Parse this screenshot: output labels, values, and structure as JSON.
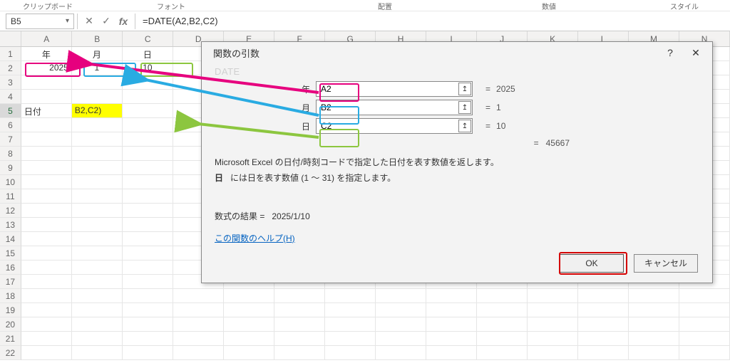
{
  "ribbon_groups": {
    "g1": "クリップボード",
    "g2": "フォント",
    "g3": "配置",
    "g4": "数値",
    "g5": "スタイル"
  },
  "name_box": "B5",
  "formula_text": "=DATE(A2,B2,C2)",
  "columns": [
    "A",
    "B",
    "C",
    "D",
    "E",
    "F",
    "G",
    "H",
    "I",
    "J",
    "K",
    "L",
    "M",
    "N"
  ],
  "rows": [
    1,
    2,
    3,
    4,
    5,
    6,
    7,
    8,
    9,
    10,
    11,
    12,
    13,
    14,
    15,
    16,
    17,
    18,
    19,
    20,
    21,
    22
  ],
  "sheet": {
    "A1": "年",
    "B1": "月",
    "C1": "日",
    "A2": "2025",
    "B2": "1",
    "C2": "10",
    "A5": "日付",
    "B5": "B2,C2)"
  },
  "dialog": {
    "title": "関数の引数",
    "fn_name": "DATE",
    "args": [
      {
        "label": "年",
        "value": "A2",
        "result": "2025",
        "color": "pink"
      },
      {
        "label": "月",
        "value": "B2",
        "result": "1",
        "color": "cyan"
      },
      {
        "label": "日",
        "value": "C2",
        "result": "10",
        "color": "green"
      }
    ],
    "serial_prefix": "=",
    "serial": "45667",
    "desc_line1": "Microsoft Excel の日付/時刻コードで指定した日付を表す数値を返します。",
    "desc_param_label": "日",
    "desc_param_text": "には日を表す数値 (1 〜 31) を指定します。",
    "formula_result_label": "数式の結果 =",
    "formula_result": "2025/1/10",
    "help_link": "この関数のヘルプ(H)",
    "ok": "OK",
    "cancel": "キャンセル"
  },
  "icons": {
    "help": "?",
    "close": "✕",
    "check": "✓",
    "cancel_x": "✕",
    "collapse": "↥",
    "chev": "▾"
  }
}
